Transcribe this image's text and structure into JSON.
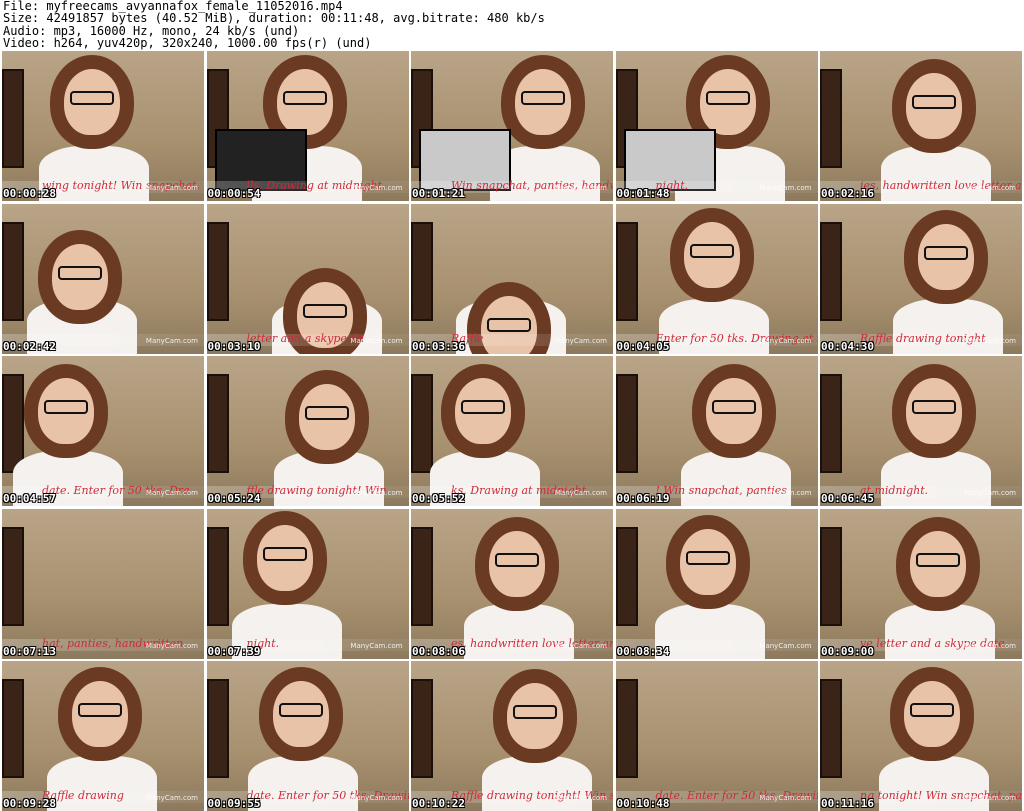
{
  "header": {
    "file": "File: myfreecams_avyannafox_female_11052016.mp4",
    "size": "Size: 42491857 bytes (40.52 MiB), duration: 00:11:48, avg.bitrate: 480 kb/s",
    "audio": "Audio: mp3, 16000 Hz, mono, 24 kb/s (und)",
    "video": "Video: h264, yuv420p, 320x240, 1000.00 fps(r) (und)"
  },
  "watermark": "ManyCam.com",
  "thumbnails": [
    {
      "time": "00:00:28",
      "ticker": "wing tonight! Win snapchat, pan"
    },
    {
      "time": "00:00:54",
      "ticker": "lls. Drawing at midnight."
    },
    {
      "time": "00:01:21",
      "ticker": "Win snapchat, panties, handwritten"
    },
    {
      "time": "00:01:48",
      "ticker": "night."
    },
    {
      "time": "00:02:16",
      "ticker": "ies, handwritten love letter and a sky"
    },
    {
      "time": "00:02:42",
      "ticker": ""
    },
    {
      "time": "00:03:10",
      "ticker": "letter and a skype da"
    },
    {
      "time": "00:03:36",
      "ticker": "Raffle"
    },
    {
      "time": "00:04:05",
      "ticker": "Enter for 50 tks. Drawing at mi"
    },
    {
      "time": "00:04:30",
      "ticker": "Raffle drawing tonight"
    },
    {
      "time": "00:04:57",
      "ticker": "date. Enter for 50 tks. Dra"
    },
    {
      "time": "00:05:24",
      "ticker": "ffle drawing tonight! Win"
    },
    {
      "time": "00:05:52",
      "ticker": "ks. Drawing at midnight."
    },
    {
      "time": "00:06:19",
      "ticker": "! Win snapchat, panties"
    },
    {
      "time": "00:06:45",
      "ticker": "at midnight."
    },
    {
      "time": "00:07:13",
      "ticker": "hat, panties, handwritten"
    },
    {
      "time": "00:07:39",
      "ticker": "night."
    },
    {
      "time": "00:08:06",
      "ticker": "es, handwritten love letter and a"
    },
    {
      "time": "00:08:34",
      "ticker": ""
    },
    {
      "time": "00:09:00",
      "ticker": "ve letter and a skype date"
    },
    {
      "time": "00:09:28",
      "ticker": "Raffle drawing"
    },
    {
      "time": "00:09:55",
      "ticker": "date. Enter for 50 tks. Drawing at"
    },
    {
      "time": "00:10:22",
      "ticker": "Raffle drawing tonight! Win snap"
    },
    {
      "time": "00:10:48",
      "ticker": "date. Enter for 50 tks. Drawing at mi"
    },
    {
      "time": "00:11:16",
      "ticker": "ng tonight! Win snapchat, pan"
    }
  ]
}
